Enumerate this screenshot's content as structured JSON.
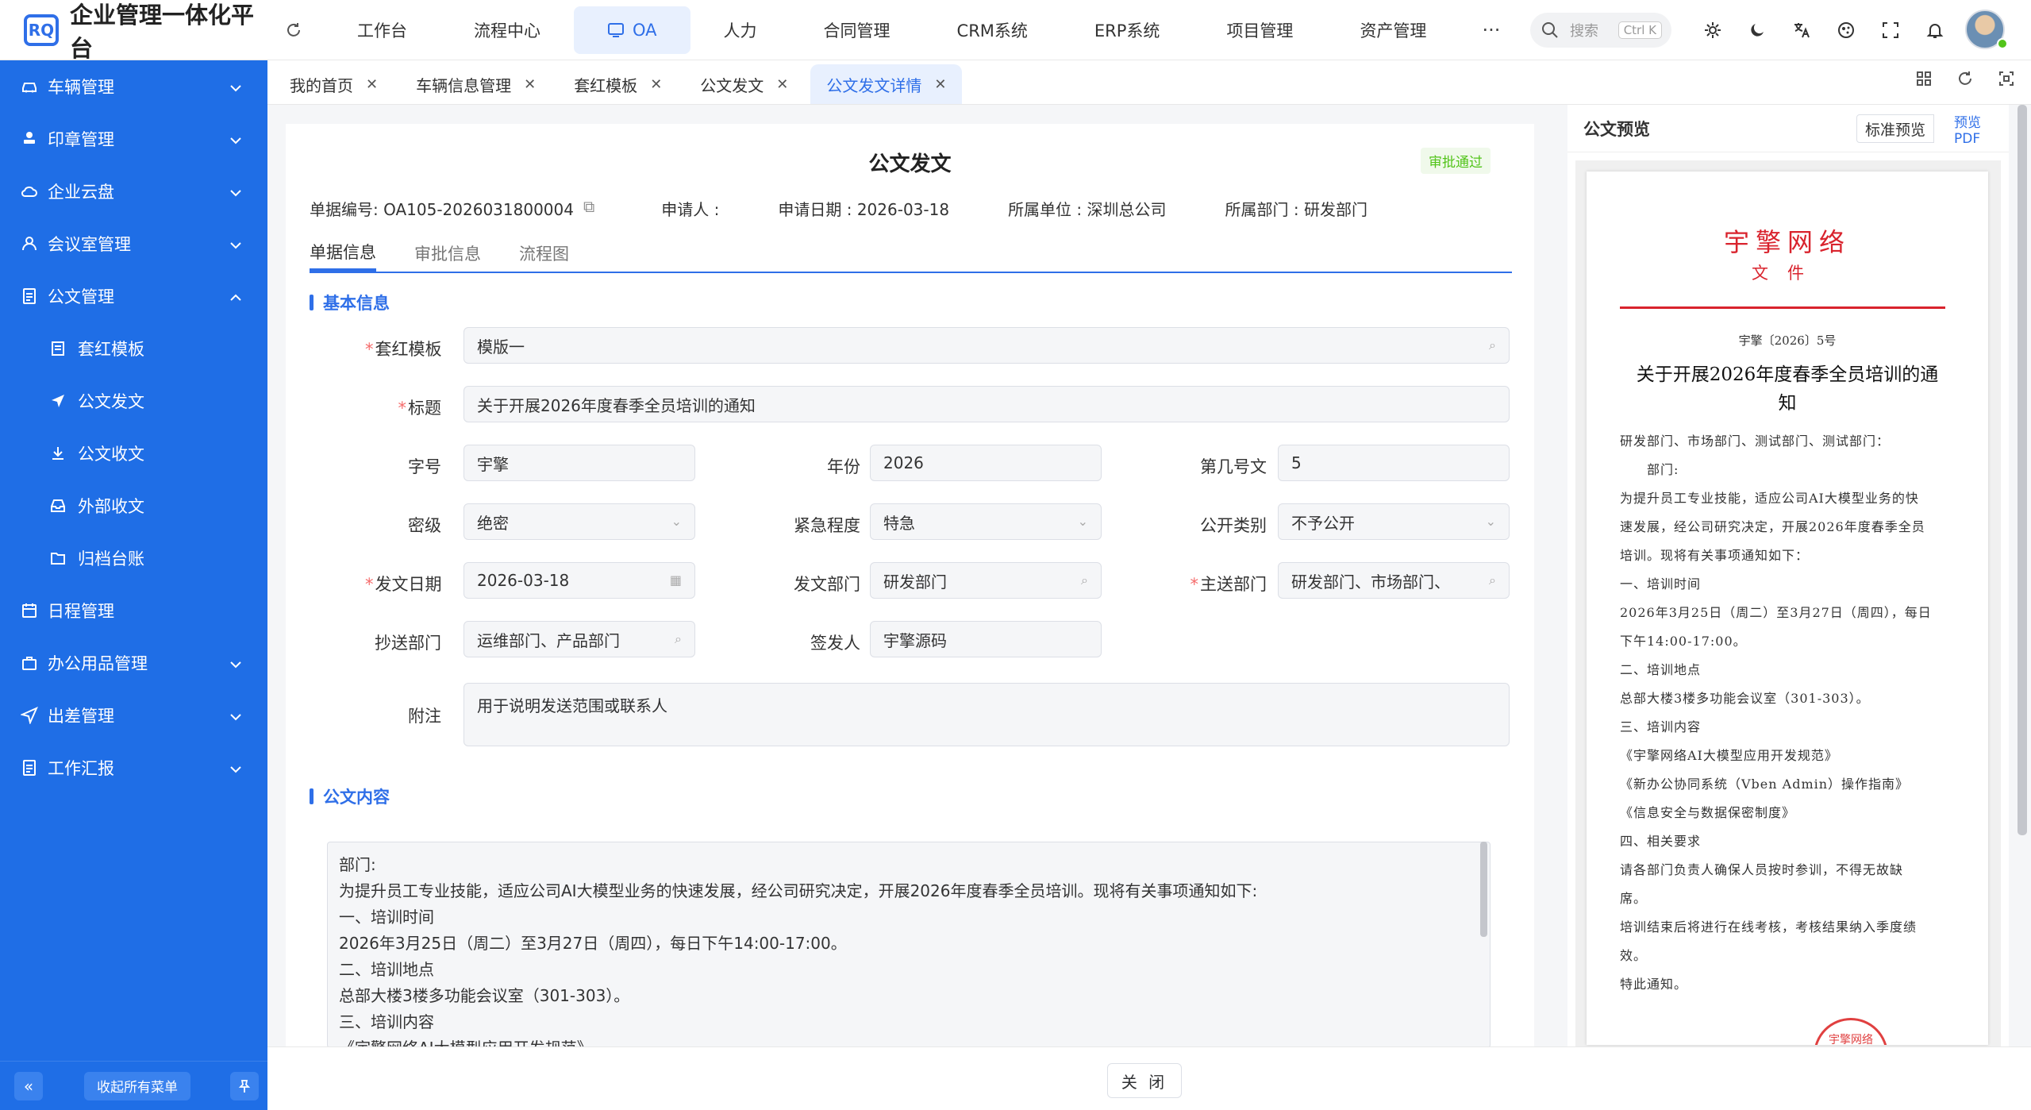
{
  "app": {
    "logo_mark": "RQ",
    "title": "企业管理一体化平台"
  },
  "topnav": {
    "items": [
      "工作台",
      "流程中心",
      "OA",
      "人力",
      "合同管理",
      "CRM系统",
      "ERP系统",
      "项目管理",
      "资产管理"
    ],
    "active": "OA",
    "more": "···",
    "search_placeholder": "搜索",
    "search_shortcut": "Ctrl K"
  },
  "sidebar": {
    "items": [
      {
        "label": "车辆管理",
        "icon": "car-icon"
      },
      {
        "label": "印章管理",
        "icon": "stamp-icon"
      },
      {
        "label": "企业云盘",
        "icon": "cloud-icon"
      },
      {
        "label": "会议室管理",
        "icon": "meeting-icon"
      },
      {
        "label": "公文管理",
        "icon": "document-icon",
        "expanded": true
      },
      {
        "label": "日程管理",
        "icon": "calendar-icon"
      },
      {
        "label": "办公用品管理",
        "icon": "bag-icon"
      },
      {
        "label": "出差管理",
        "icon": "send-icon"
      },
      {
        "label": "工作汇报",
        "icon": "report-icon"
      }
    ],
    "sub_items": [
      "套红模板",
      "公文发文",
      "公文收文",
      "外部收文",
      "归档台账"
    ],
    "collapse_all": "收起所有菜单"
  },
  "tabs": [
    "我的首页",
    "车辆信息管理",
    "套红模板",
    "公文发文",
    "公文发文详情"
  ],
  "active_tab": "公文发文详情",
  "form": {
    "title": "公文发文",
    "status": "审批通过",
    "meta": {
      "doc_no": "单据编号: OA105-2026031800004",
      "applicant": "申请人 :",
      "apply_date": "申请日期 : 2026-03-18",
      "unit": "所属单位 : 深圳总公司",
      "dept": "所属部门 : 研发部门"
    },
    "subtabs": [
      "单据信息",
      "审批信息",
      "流程图"
    ],
    "section_basic": "基本信息",
    "section_content": "公文内容",
    "labels": {
      "template": "套红模板",
      "title": "标题",
      "word": "字号",
      "year": "年份",
      "number": "第几号文",
      "secret": "密级",
      "urgency": "紧急程度",
      "public": "公开类别",
      "date": "发文日期",
      "send_dept": "发文部门",
      "main_dept": "主送部门",
      "cc_dept": "抄送部门",
      "signer": "签发人",
      "note": "附注"
    },
    "values": {
      "template": "模版一",
      "title": "关于开展2026年度春季全员培训的通知",
      "word": "宇擎",
      "year": "2026",
      "number": "5",
      "secret": "绝密",
      "urgency": "特急",
      "public": "不予公开",
      "date": "2026-03-18",
      "send_dept": "研发部门",
      "main_dept": "研发部门、市场部门、",
      "cc_dept": "运维部门、产品部门",
      "signer": "宇擎源码",
      "note": "用于说明发送范围或联系人"
    },
    "content_lines": [
      "部门:",
      "为提升员工专业技能，适应公司AI大模型业务的快速发展，经公司研究决定，开展2026年度春季全员培训。现将有关事项通知如下:",
      "一、培训时间",
      "2026年3月25日（周二）至3月27日（周四），每日下午14:00-17:00。",
      "二、培训地点",
      "总部大楼3楼多功能会议室（301-303）。",
      "三、培训内容",
      "《宇擎网络AI大模型应用开发规范》"
    ],
    "close": "关 闭"
  },
  "preview": {
    "title": "公文预览",
    "std": "标准预览",
    "pdf": "预览PDF",
    "org": "宇擎网络",
    "doc": "文件",
    "no": "宇擎〔2026〕5号",
    "doc_title": "关于开展2026年度春季全员培训的通知",
    "body": [
      "研发部门、市场部门、测试部门、测试部门：",
      "　　部门:",
      "为提升员工专业技能，适应公司AI大模型业务的快",
      "速发展，经公司研究决定，开展2026年度春季全员",
      "培训。现将有关事项通知如下：",
      "一、培训时间",
      "2026年3月25日（周二）至3月27日（周四），每日",
      "下午14:00-17:00。",
      "二、培训地点",
      "总部大楼3楼多功能会议室（301-303）。",
      "三、培训内容",
      "《宇擎网络AI大模型应用开发规范》",
      "《新办公协同系统（Vben Admin）操作指南》",
      "《信息安全与数据保密制度》",
      "四、相关要求",
      "请各部门负责人确保人员按时参训，不得无故缺",
      "席。",
      "培训结束后将进行在线考核，考核结果纳入季度绩",
      "效。",
      "特此通知。"
    ],
    "stamp": "宇擎网络"
  },
  "colors": {
    "primary": "#2f6fe8",
    "sidebar": "#1f6ee6",
    "red": "#d9232d",
    "success": "#52c41a"
  }
}
